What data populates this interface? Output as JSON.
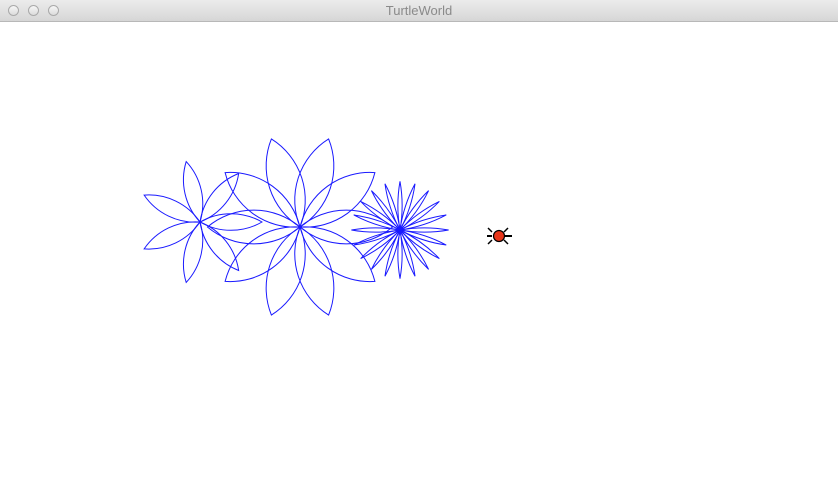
{
  "window": {
    "title": "TurtleWorld"
  },
  "colors": {
    "pen": "#1a1aff",
    "turtle_body": "#e8361b",
    "turtle_outline": "#000000",
    "canvas_bg": "#ffffff"
  },
  "flowers": [
    {
      "petals": 7,
      "petal_angle_deg": 60
    },
    {
      "petals": 10,
      "petal_angle_deg": 80
    },
    {
      "petals": 20,
      "petal_angle_deg": 20
    }
  ],
  "turtle": {
    "icon": "turtle-icon",
    "heading_deg": 0
  }
}
